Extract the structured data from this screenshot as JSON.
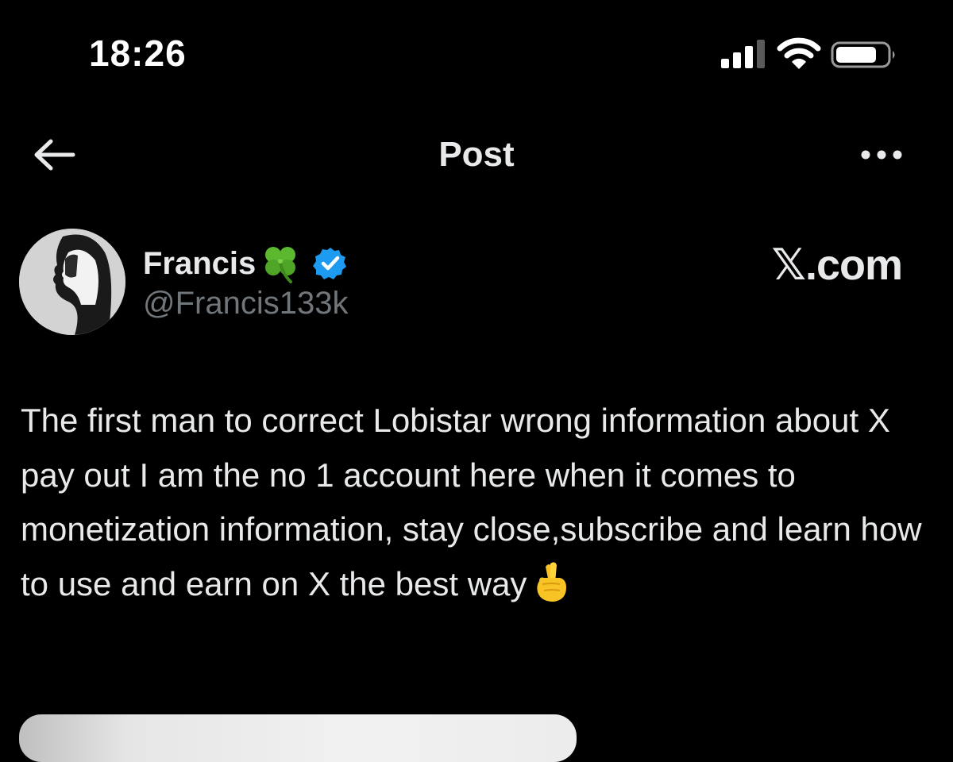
{
  "status_bar": {
    "time": "18:26",
    "icons": [
      "signal-bars-icon",
      "wifi-icon",
      "battery-icon"
    ]
  },
  "header": {
    "title": "Post",
    "back_icon": "arrow-left-icon",
    "more_icon": "more-horizontal-icon"
  },
  "author": {
    "display_name": "Francis",
    "name_emoji_icon": "four-leaf-clover-icon",
    "verified_icon": "verified-badge-icon",
    "verified_color": "#1d9bf0",
    "handle": "@Francis133k"
  },
  "watermark": "𝕏.com",
  "post": {
    "text": "The first man to correct Lobistar wrong information about X pay out I am the no 1 account here when it comes to monetization information, stay close,subscribe and learn how to use and earn on X the best way",
    "trailing_emoji_icon": "crossed-fingers-icon"
  },
  "colors": {
    "background": "#000000",
    "text_primary": "#e7e9ea",
    "text_secondary": "#71767b",
    "accent": "#1d9bf0"
  }
}
